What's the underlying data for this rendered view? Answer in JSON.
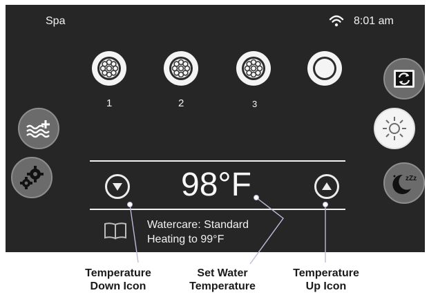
{
  "status_bar": {
    "title": "Spa",
    "time": "8:01 am",
    "wifi_icon": "wifi-icon"
  },
  "jets": [
    {
      "label": "1",
      "icon": "jet-pump-icon"
    },
    {
      "label": "2",
      "icon": "jet-pump-icon"
    },
    {
      "label": "3",
      "icon": "jet-pump-icon"
    },
    {
      "label": "",
      "icon": "light-ring-icon"
    }
  ],
  "left_buttons": [
    {
      "icon": "water-add-icon"
    },
    {
      "icon": "gears-icon"
    }
  ],
  "right_buttons": [
    {
      "icon": "filter-cycle-icon"
    },
    {
      "icon": "sun-light-icon"
    },
    {
      "icon": "sleep-moon-icon"
    }
  ],
  "temperature": {
    "value": "98°F",
    "down_icon": "triangle-down-icon",
    "up_icon": "triangle-up-icon"
  },
  "status": {
    "watercare": "Watercare: Standard",
    "heating": "Heating to 99°F",
    "icon": "book-icon"
  },
  "captions": {
    "down": [
      "Temperature",
      "Down Icon"
    ],
    "set": [
      "Set Water",
      "Temperature"
    ],
    "up": [
      "Temperature",
      "Up Icon"
    ]
  },
  "colors": {
    "screen": "#262626",
    "button_gray": "#6b6b6b",
    "text": "#f2f2f2"
  }
}
